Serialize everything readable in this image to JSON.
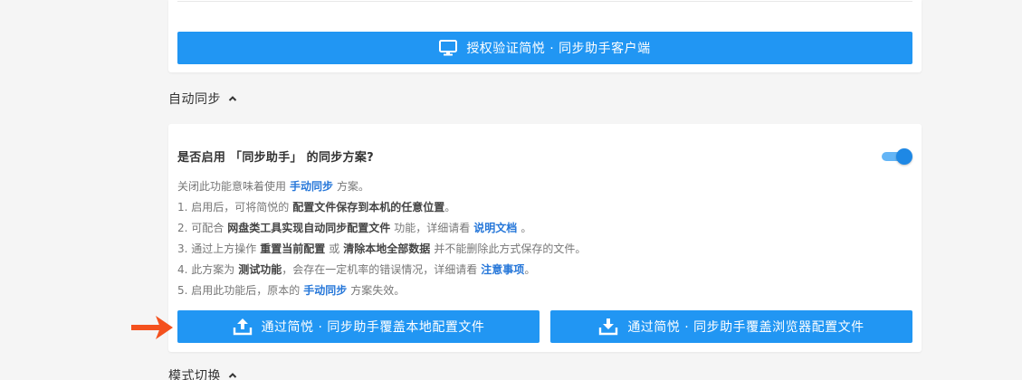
{
  "auth_card": {
    "button_label": "授权验证简悦 · 同步助手客户端",
    "button_icon": "monitor-icon"
  },
  "auto_sync_section": {
    "title": "自动同步",
    "expand_icon": "chevron-up-icon"
  },
  "option": {
    "question": "是否启用 「同步助手」 的同步方案?",
    "enabled": true,
    "toggle_color": "#1e88e5",
    "lines": [
      {
        "pre": "关闭此功能意味着使用",
        "em": "手动同步",
        "post": "方案。",
        "em_type": "link"
      },
      {
        "pre": "1. 启用后，可将简悦的",
        "em": "配置文件保存到本机的任意位置",
        "post": "。",
        "em_type": "bold"
      },
      {
        "pre": "2. 可配合",
        "em": "网盘类工具实现自动同步配置文件",
        "mid": "功能，详细请看",
        "link": "说明文档",
        "post": "。"
      },
      {
        "pre": "3. 通过上方操作",
        "em": "重置当前配置",
        "mid": "或",
        "em2": "清除本地全部数据",
        "post": "并不能删除此方式保存的文件。"
      },
      {
        "pre": "4. 此方案为",
        "em": "测试功能",
        "mid": "，会存在一定机率的错误情况，详细请看",
        "link": "注意事项",
        "post": "。"
      },
      {
        "pre": "5. 启用此功能后，原本的",
        "em": "手动同步",
        "post": "方案失效。",
        "em_type": "link"
      }
    ]
  },
  "actions": {
    "local_label": "通过简悦 · 同步助手覆盖本地配置文件",
    "local_icon": "upload-icon",
    "browser_label": "通过简悦 · 同步助手覆盖浏览器配置文件",
    "browser_icon": "download-icon",
    "button_color": "#2196f3"
  },
  "annotation": {
    "arrow_icon": "arrow-right-icon",
    "arrow_color": "#f4511e"
  },
  "mode_section": {
    "title": "模式切换",
    "expand_icon": "chevron-up-icon"
  }
}
